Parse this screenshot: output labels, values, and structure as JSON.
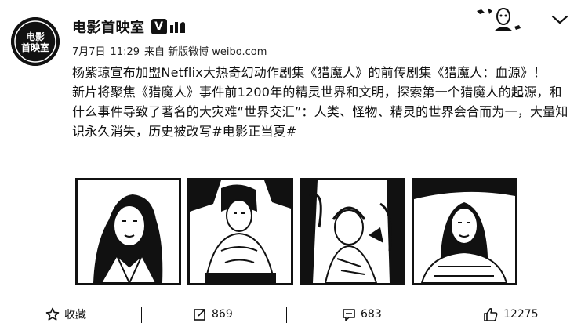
{
  "account": {
    "name": "电影首映室",
    "verified_mark": "V",
    "avatar_text": "电影首映室"
  },
  "post": {
    "date": "7月7日",
    "time": "11:29",
    "source": "来自 新版微博 weibo.com",
    "paragraph1": "杨紫琼宣布加盟Netflix大热奇幻动作剧集《猎魔人》的前传剧集《猎魔人：血源》！",
    "paragraph2": "新片将聚焦《猎魔人》事件前1200年的精灵世界和文明，探索第一个猎魔人的起源，和什么事件导致了著名的大灾难“世界交汇”：人类、怪物、精灵的世界会合而为一，大量知识永久消失，历史被改写#电影正当夏#"
  },
  "actions": {
    "favorite_label": "收藏",
    "repost_count": "869",
    "comment_count": "683",
    "like_count": "12275"
  },
  "icons": {
    "favorite": "star-icon",
    "repost": "share-icon",
    "comment": "comment-icon",
    "like": "thumbs-up-icon",
    "more": "chevron-down-icon",
    "verified": "verified-icon"
  }
}
